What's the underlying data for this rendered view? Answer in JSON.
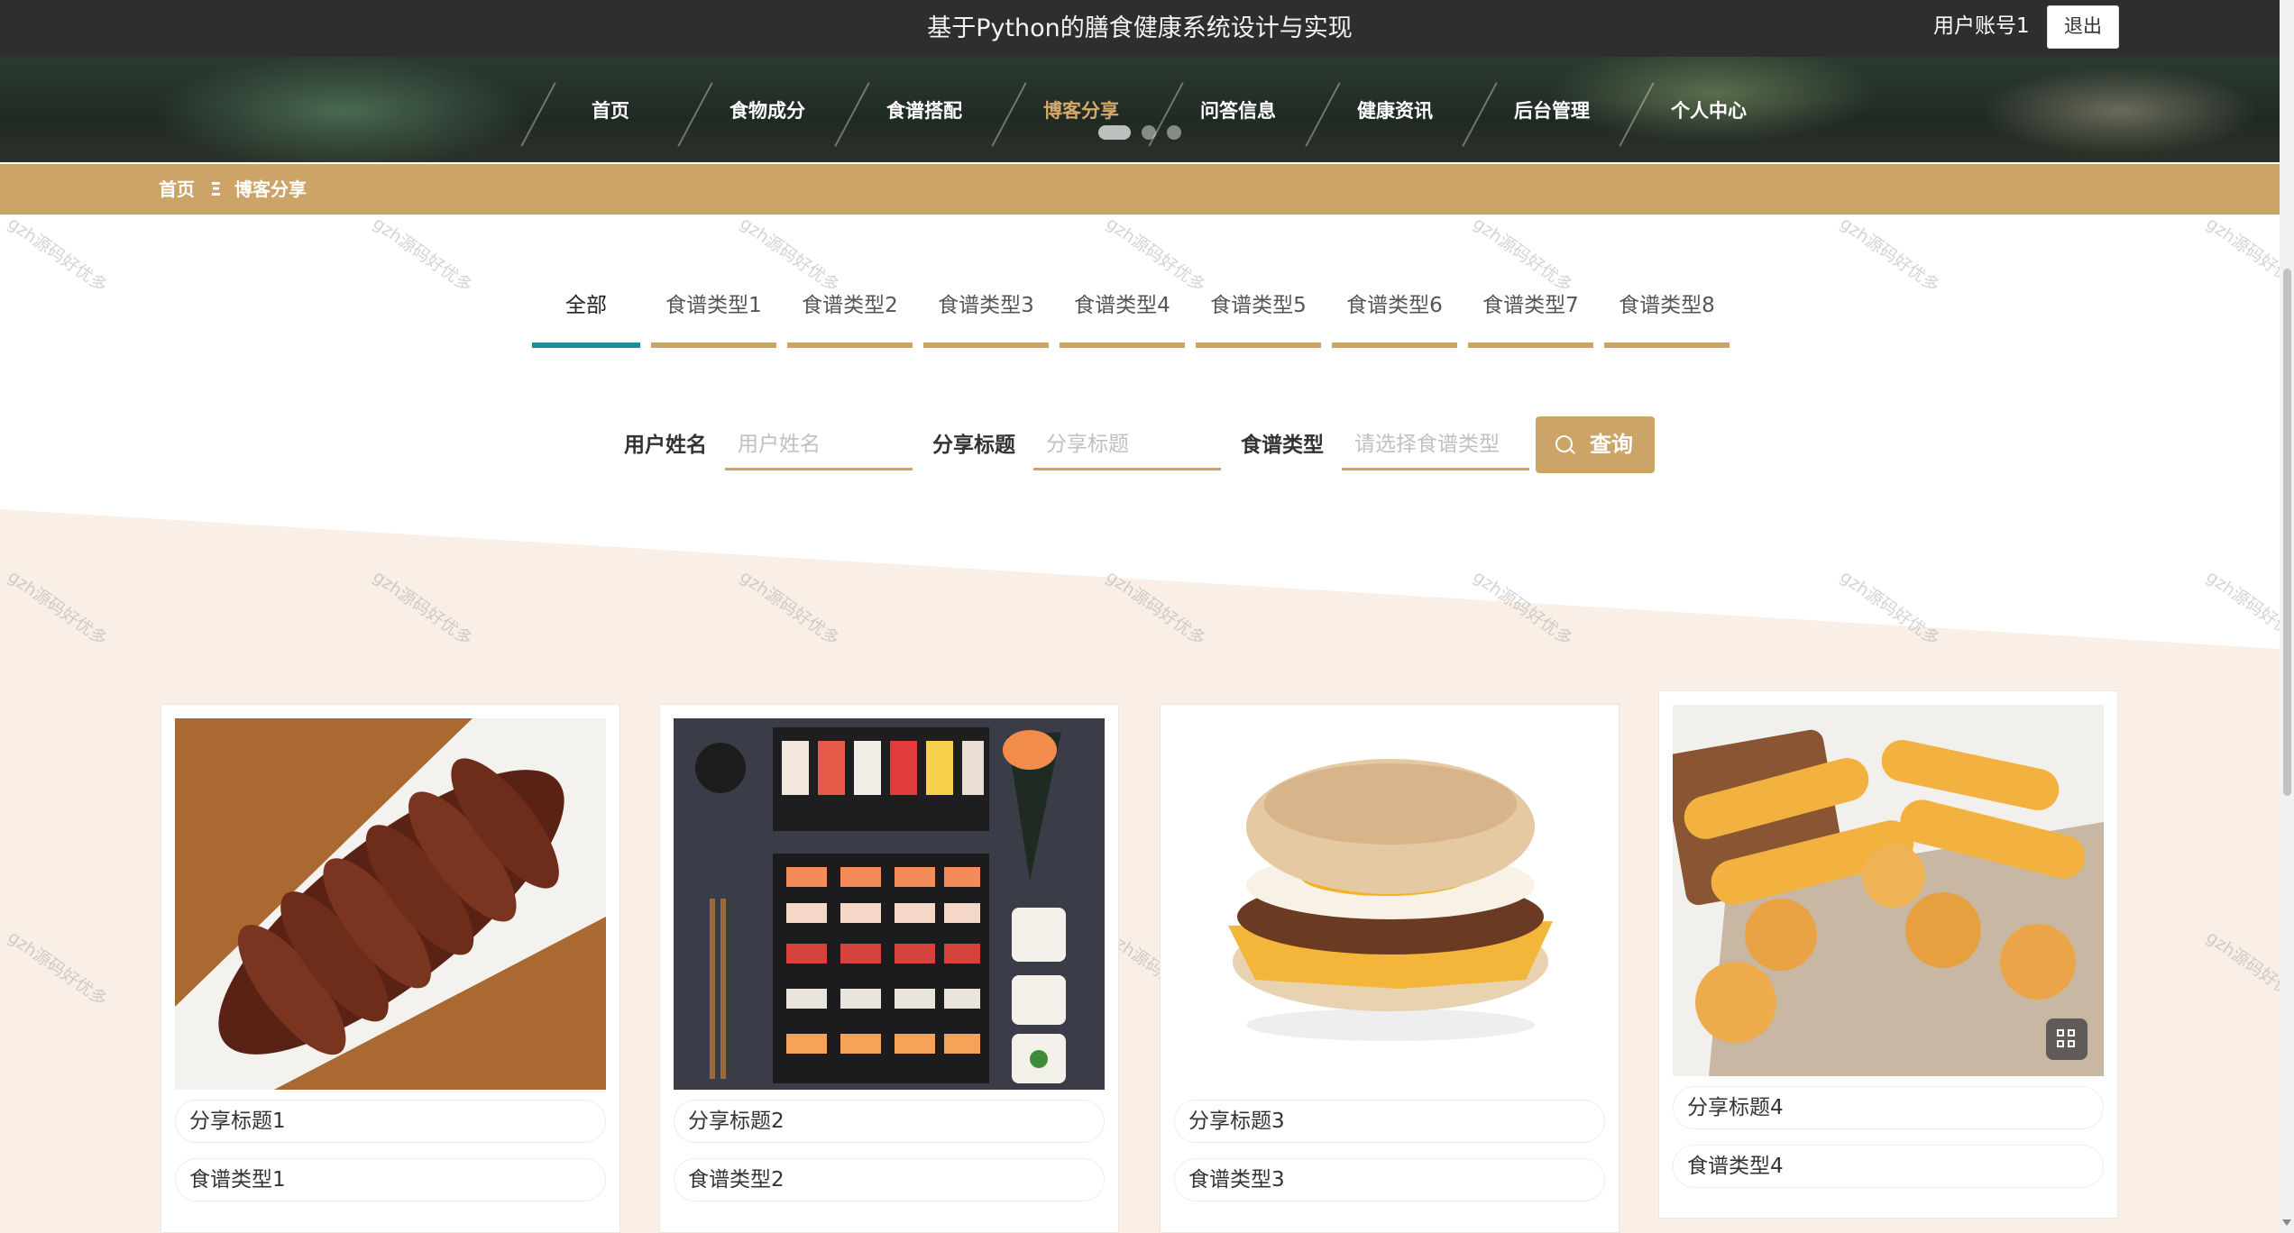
{
  "header": {
    "title": "基于Python的膳食健康系统设计与实现",
    "account": "用户账号1",
    "logout": "退出"
  },
  "nav": [
    {
      "label": "首页"
    },
    {
      "label": "食物成分"
    },
    {
      "label": "食谱搭配"
    },
    {
      "label": "博客分享",
      "active": true
    },
    {
      "label": "问答信息"
    },
    {
      "label": "健康资讯"
    },
    {
      "label": "后台管理"
    },
    {
      "label": "个人中心"
    }
  ],
  "breadcrumb": {
    "home": "首页",
    "separator": "Ξ",
    "current": "博客分享"
  },
  "tabs": [
    {
      "label": "全部",
      "active": true
    },
    {
      "label": "食谱类型1"
    },
    {
      "label": "食谱类型2"
    },
    {
      "label": "食谱类型3"
    },
    {
      "label": "食谱类型4"
    },
    {
      "label": "食谱类型5"
    },
    {
      "label": "食谱类型6"
    },
    {
      "label": "食谱类型7"
    },
    {
      "label": "食谱类型8"
    }
  ],
  "search": {
    "username_label": "用户姓名",
    "username_placeholder": "用户姓名",
    "title_label": "分享标题",
    "title_placeholder": "分享标题",
    "type_label": "食谱类型",
    "type_placeholder": "请选择食谱类型",
    "button": "查询"
  },
  "watermark": "gzh源码好优多",
  "cards": [
    {
      "title": "分享标题1",
      "type": "食谱类型1",
      "image": "braised-lotus-root-photo"
    },
    {
      "title": "分享标题2",
      "type": "食谱类型2",
      "image": "sushi-platter-photo"
    },
    {
      "title": "分享标题3",
      "type": "食谱类型3",
      "image": "breakfast-muffin-photo"
    },
    {
      "title": "分享标题4",
      "type": "食谱类型4",
      "image": "bread-pastries-photo"
    }
  ],
  "colors": {
    "accent": "#cda467",
    "tab_active": "#1c8f9a",
    "header_bg": "#2e2e2e",
    "section_bg": "#f9efe6"
  }
}
